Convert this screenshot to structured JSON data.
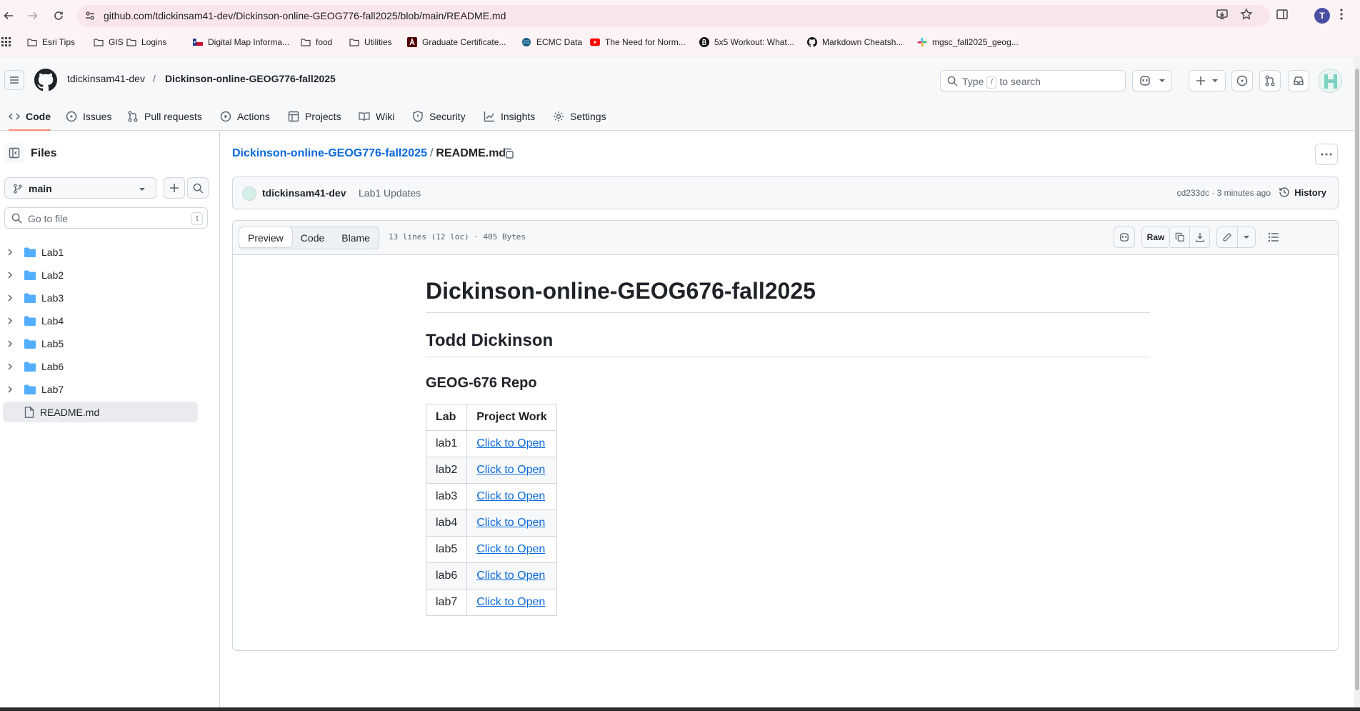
{
  "browser": {
    "url": "github.com/tdickinsam41-dev/Dickinson-online-GEOG776-fall2025/blob/main/README.md",
    "profile_initial": "T",
    "bookmarks": [
      {
        "label": "Esri Tips",
        "icon": "folder-icon"
      },
      {
        "label": "GIS",
        "icon": "folder-icon"
      },
      {
        "label": "Logins",
        "icon": "folder-icon"
      },
      {
        "label": "Digital Map Informa...",
        "icon": "texas-flag-icon"
      },
      {
        "label": "food",
        "icon": "folder-icon"
      },
      {
        "label": "Utilities",
        "icon": "folder-icon"
      },
      {
        "label": "Graduate Certificate...",
        "icon": "tamu-icon"
      },
      {
        "label": "ECMC Data",
        "icon": "globe-icon"
      },
      {
        "label": "The Need for Norm...",
        "icon": "youtube-icon"
      },
      {
        "label": "5x5 Workout: What...",
        "icon": "b-icon"
      },
      {
        "label": "Markdown Cheatsh...",
        "icon": "github-icon"
      },
      {
        "label": "mgsc_fall2025_geog...",
        "icon": "slack-icon"
      }
    ]
  },
  "header": {
    "owner": "tdickinsam41-dev",
    "separator": "/",
    "repo": "Dickinson-online-GEOG776-fall2025",
    "search_prefix": "Type",
    "search_key": "/",
    "search_suffix": "to search"
  },
  "tabs": [
    {
      "label": "Code",
      "icon": "code-icon",
      "active": true
    },
    {
      "label": "Issues",
      "icon": "issue-icon"
    },
    {
      "label": "Pull requests",
      "icon": "pull-request-icon"
    },
    {
      "label": "Actions",
      "icon": "play-icon"
    },
    {
      "label": "Projects",
      "icon": "table-icon"
    },
    {
      "label": "Wiki",
      "icon": "book-icon"
    },
    {
      "label": "Security",
      "icon": "shield-icon"
    },
    {
      "label": "Insights",
      "icon": "graph-icon"
    },
    {
      "label": "Settings",
      "icon": "gear-icon"
    }
  ],
  "sidebar": {
    "title": "Files",
    "branch": "main",
    "goto_placeholder": "Go to file",
    "goto_key": "t",
    "items": [
      {
        "label": "Lab1",
        "type": "folder"
      },
      {
        "label": "Lab2",
        "type": "folder"
      },
      {
        "label": "Lab3",
        "type": "folder"
      },
      {
        "label": "Lab4",
        "type": "folder"
      },
      {
        "label": "Lab5",
        "type": "folder"
      },
      {
        "label": "Lab6",
        "type": "folder"
      },
      {
        "label": "Lab7",
        "type": "folder"
      },
      {
        "label": "README.md",
        "type": "file",
        "selected": true
      }
    ]
  },
  "path": {
    "repo": "Dickinson-online-GEOG776-fall2025",
    "sep": "/",
    "file": "README.md"
  },
  "commit": {
    "author": "tdickinsam41-dev",
    "message": "Lab1 Updates",
    "meta": "cd233dc · 3 minutes ago",
    "history_label": "History"
  },
  "file_header": {
    "tabs": [
      "Preview",
      "Code",
      "Blame"
    ],
    "info": "13 lines (12 loc) · 405 Bytes",
    "raw_label": "Raw"
  },
  "readme": {
    "h1": "Dickinson-online-GEOG676-fall2025",
    "h2": "Todd Dickinson",
    "h3": "GEOG-676 Repo",
    "table_headers": [
      "Lab",
      "Project Work"
    ],
    "rows": [
      {
        "lab": "lab1",
        "link": "Click to Open"
      },
      {
        "lab": "lab2",
        "link": "Click to Open"
      },
      {
        "lab": "lab3",
        "link": "Click to Open"
      },
      {
        "lab": "lab4",
        "link": "Click to Open"
      },
      {
        "lab": "lab5",
        "link": "Click to Open"
      },
      {
        "lab": "lab6",
        "link": "Click to Open"
      },
      {
        "lab": "lab7",
        "link": "Click to Open"
      }
    ]
  },
  "colors": {
    "accent_link": "#0969da",
    "active_tab_underline": "#fd8c73",
    "folder": "#54aeff"
  }
}
